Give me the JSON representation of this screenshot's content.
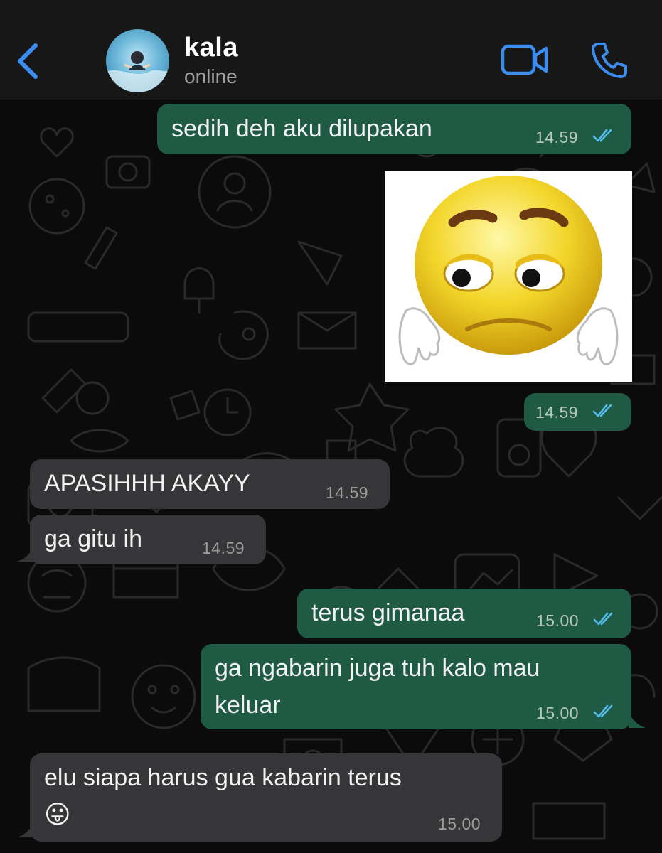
{
  "header": {
    "contact_name": "kala",
    "contact_status": "online"
  },
  "colors": {
    "accent": "#3b8ef0",
    "outgoing_bubble": "#1f5a44",
    "incoming_bubble": "#363638",
    "read_ticks": "#53bdeb"
  },
  "messages": [
    {
      "direction": "out",
      "text": "sedih deh aku dilupakan",
      "time": "14.59",
      "status": "read"
    },
    {
      "direction": "out",
      "type": "sticker",
      "sticker": "sad-face-sticker",
      "time": "14.59",
      "status": "read"
    },
    {
      "direction": "in",
      "text": "APASIHHH AKAYY",
      "time": "14.59"
    },
    {
      "direction": "in",
      "text": "ga gitu ih",
      "time": "14.59"
    },
    {
      "direction": "out",
      "text": "terus gimanaa",
      "time": "15.00",
      "status": "read"
    },
    {
      "direction": "out",
      "text": "ga ngabarin juga tuh kalo mau",
      "text_line2": "keluar",
      "time": "15.00",
      "status": "read"
    },
    {
      "direction": "in",
      "text": "elu siapa harus gua kabarin terus",
      "emoji": "😛",
      "time": "15.00"
    }
  ]
}
